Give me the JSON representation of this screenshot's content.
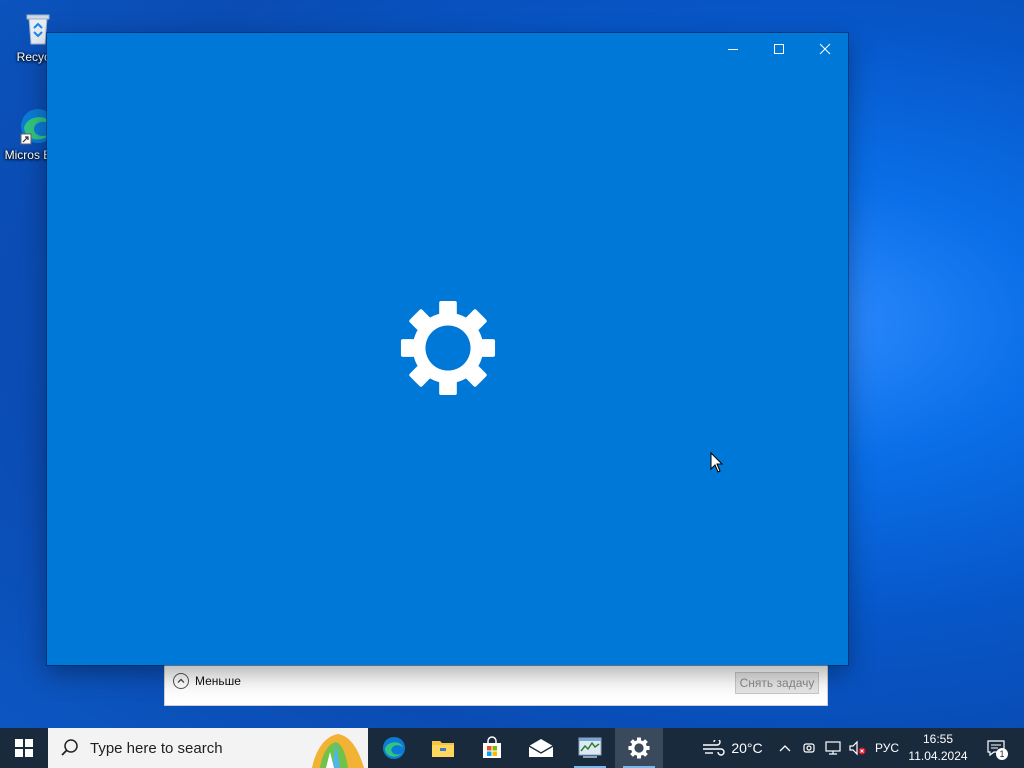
{
  "desktop": {
    "icons": [
      {
        "label": "Recycle",
        "icon": "recycle-bin-icon"
      },
      {
        "label": "Micros Edge",
        "icon": "edge-icon"
      }
    ]
  },
  "window": {
    "controls": {
      "minimize": "minimize-icon",
      "maximize": "maximize-icon",
      "close": "close-icon"
    },
    "splash_icon": "gear-icon",
    "background": "#0078d7"
  },
  "task_manager": {
    "less_label": "Меньше",
    "end_task_label": "Снять задачу"
  },
  "taskbar": {
    "search_placeholder": "Type here to search",
    "pinned": [
      {
        "name": "edge",
        "icon": "edge-icon"
      },
      {
        "name": "file-explorer",
        "icon": "folder-icon"
      },
      {
        "name": "store",
        "icon": "store-icon"
      },
      {
        "name": "mail",
        "icon": "mail-icon"
      },
      {
        "name": "task-manager",
        "icon": "task-manager-icon"
      },
      {
        "name": "settings",
        "icon": "gear-icon"
      }
    ],
    "weather": "20°C",
    "language": "РУС",
    "time": "16:55",
    "date": "11.04.2024",
    "notifications_count": "1"
  }
}
